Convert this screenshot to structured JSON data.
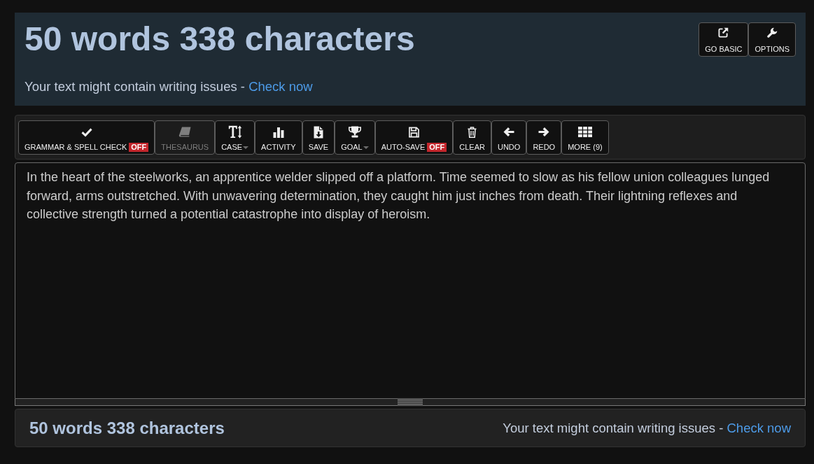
{
  "header": {
    "title": "50 words 338 characters",
    "notice": "Your text might contain writing issues -",
    "link": "Check now",
    "buttons": [
      {
        "kind": "go-basic",
        "label": "GO BASIC"
      },
      {
        "kind": "options",
        "label": "OPTIONS"
      }
    ]
  },
  "toolbar": {
    "buttons": [
      {
        "kind": "grammar",
        "label": "GRAMMAR & SPELL CHECK",
        "badge": "OFF",
        "disabled": false,
        "dropdown": false
      },
      {
        "kind": "thesaurus",
        "label": "THESAURUS",
        "disabled": true,
        "dropdown": false
      },
      {
        "kind": "case",
        "label": "CASE",
        "disabled": false,
        "dropdown": true
      },
      {
        "kind": "activity",
        "label": "ACTIVITY",
        "disabled": false,
        "dropdown": false
      },
      {
        "kind": "save",
        "label": "SAVE",
        "disabled": false,
        "dropdown": false
      },
      {
        "kind": "goal",
        "label": "GOAL",
        "disabled": false,
        "dropdown": true
      },
      {
        "kind": "autosave",
        "label": "AUTO-SAVE",
        "badge": "OFF",
        "disabled": false,
        "dropdown": false
      },
      {
        "kind": "clear",
        "label": "CLEAR",
        "disabled": false,
        "dropdown": false
      },
      {
        "kind": "undo",
        "label": "UNDO",
        "disabled": false,
        "dropdown": false
      },
      {
        "kind": "redo",
        "label": "REDO",
        "disabled": false,
        "dropdown": false
      },
      {
        "kind": "more",
        "label": "MORE (9)",
        "disabled": false,
        "dropdown": false
      }
    ]
  },
  "editor": {
    "value": "In the heart of the steelworks, an apprentice welder slipped off a platform. Time seemed to slow as his fellow union colleagues lunged forward, arms outstretched. With unwavering determination, they caught him just inches from death. Their lightning reflexes and collective strength turned a potential catastrophe into display of heroism."
  },
  "footer": {
    "title": "50 words 338 characters",
    "notice": "Your text might contain writing issues -",
    "link": "Check now"
  }
}
